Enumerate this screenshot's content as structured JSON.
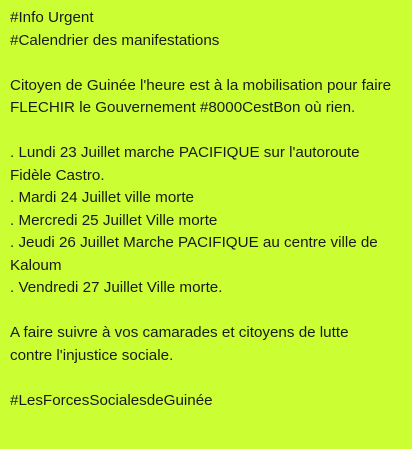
{
  "post": {
    "header": {
      "line1": "#Info Urgent",
      "line2": "#Calendrier des manifestations"
    },
    "intro": {
      "line1": "Citoyen de Guinée l'heure est à la mobilisation pour faire",
      "line2": "FLECHIR le Gouvernement  #8000CestBon où rien."
    },
    "schedule": {
      "item1_line1": ". Lundi 23 Juillet marche PACIFIQUE sur l'autoroute",
      "item1_line2": "Fidèle Castro.",
      "item2": ". Mardi 24 Juillet ville morte",
      "item3": ". Mercredi 25 Juillet Ville morte",
      "item4_line1": ". Jeudi 26 Juillet  Marche PACIFIQUE au centre ville de",
      "item4_line2": "Kaloum",
      "item5": ". Vendredi 27 Juillet Ville morte."
    },
    "closing": {
      "line1": "A faire suivre à  vos camarades et citoyens de lutte",
      "line2": "contre l'injustice sociale."
    },
    "hashtag": "#LesForcesSocialesdeGuinée"
  },
  "colors": {
    "background": "#ccff33",
    "text": "#1a1a1a"
  }
}
